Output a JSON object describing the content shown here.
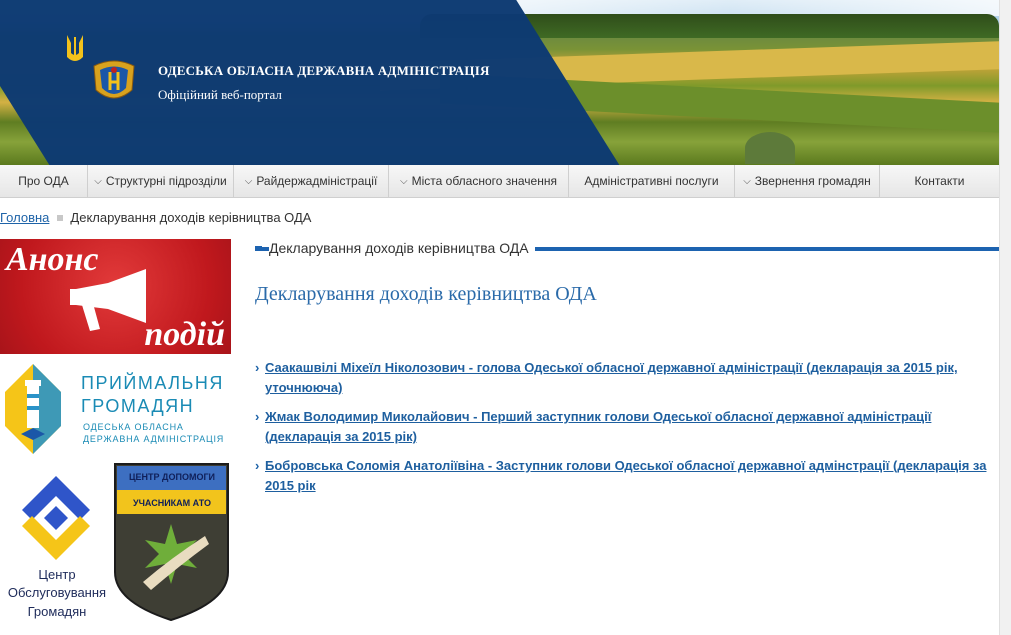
{
  "header": {
    "org_title": "ОДЕСЬКА ОБЛАСНА ДЕРЖАВНА АДМІНІСТРАЦІЯ",
    "org_subtitle": "Офіційний веб-портал"
  },
  "nav": {
    "items": [
      {
        "label": "Про ОДА",
        "has_dropdown": false
      },
      {
        "label": "Структурні підрозділи",
        "has_dropdown": true
      },
      {
        "label": "Райдержадміністрації",
        "has_dropdown": true
      },
      {
        "label": "Міста обласного значення",
        "has_dropdown": true
      },
      {
        "label": "Адміністративні послуги",
        "has_dropdown": false
      },
      {
        "label": "Звернення громадян",
        "has_dropdown": true
      },
      {
        "label": "Контакти",
        "has_dropdown": false
      }
    ]
  },
  "breadcrumb": {
    "home": "Головна",
    "current": "Декларування доходів керівництва ОДА"
  },
  "sidebar": {
    "anons": {
      "word1": "Анонс",
      "word2": "подій"
    },
    "pryimalnia": {
      "line1": "ПРИЙМАЛЬНЯ",
      "line2": "ГРОМАДЯН",
      "line3": "ОДЕСЬКА ОБЛАСНА",
      "line4": "ДЕРЖАВНА АДМІНІСТРАЦІЯ"
    },
    "cnap": {
      "line1": "Центр",
      "line2": "Обслуговування",
      "line3": "Громадян"
    },
    "ato": {
      "line1": "ЦЕНТР ДОПОМОГИ",
      "line2": "УЧАСНИКАМ АТО"
    }
  },
  "main": {
    "section_header": "Декларування доходів керівництва ОДА",
    "title": "Декларування доходів керівництва ОДА",
    "documents": [
      {
        "text": "Саакашвілі Міхеїл Ніколозович - голова Одеської обласної державної адміністрації  (декларація за 2015 рік, уточнююча)"
      },
      {
        "text": "Жмак Володимир Миколайович - Перший заступник голови Одеської обласної державної адміністрації (декларація за 2015 рік)"
      },
      {
        "text": "Бобровська Соломія Анатоліївіна - Заступник голови Одеської обласної державної адмінстрації  (декларація за 2015 рік"
      }
    ]
  },
  "colors": {
    "brand_blue": "#0d3a72",
    "accent_blue": "#1d63b0",
    "link_blue": "#1e5f9f",
    "anons_red": "#c0181d",
    "cnap_yellow": "#f5c518"
  }
}
